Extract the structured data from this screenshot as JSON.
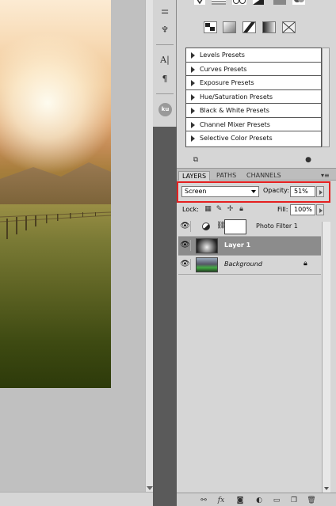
{
  "adjustment_presets": [
    "Levels Presets",
    "Curves Presets",
    "Exposure Presets",
    "Hue/Saturation Presets",
    "Black & White Presets",
    "Channel Mixer Presets",
    "Selective Color Presets"
  ],
  "tabs": [
    "LAYERS",
    "PATHS",
    "CHANNELS"
  ],
  "blend_mode": "Screen",
  "opacity_label": "Opacity:",
  "opacity_value": "51%",
  "lock_label": "Lock:",
  "fill_label": "Fill:",
  "fill_value": "100%",
  "layers": [
    {
      "name": "Photo Filter 1",
      "selected": false
    },
    {
      "name": "Layer 1",
      "selected": true
    },
    {
      "name": "Background",
      "selected": false,
      "locked": true
    }
  ],
  "dock_icon_text": {
    "ku": "ku"
  },
  "icons": {
    "eye": "eye-icon",
    "lock": "lock-icon"
  },
  "colors": {
    "highlight_border": "#e52020",
    "selected_layer": "#8c8c8c",
    "panel_bg": "#d6d6d6"
  }
}
